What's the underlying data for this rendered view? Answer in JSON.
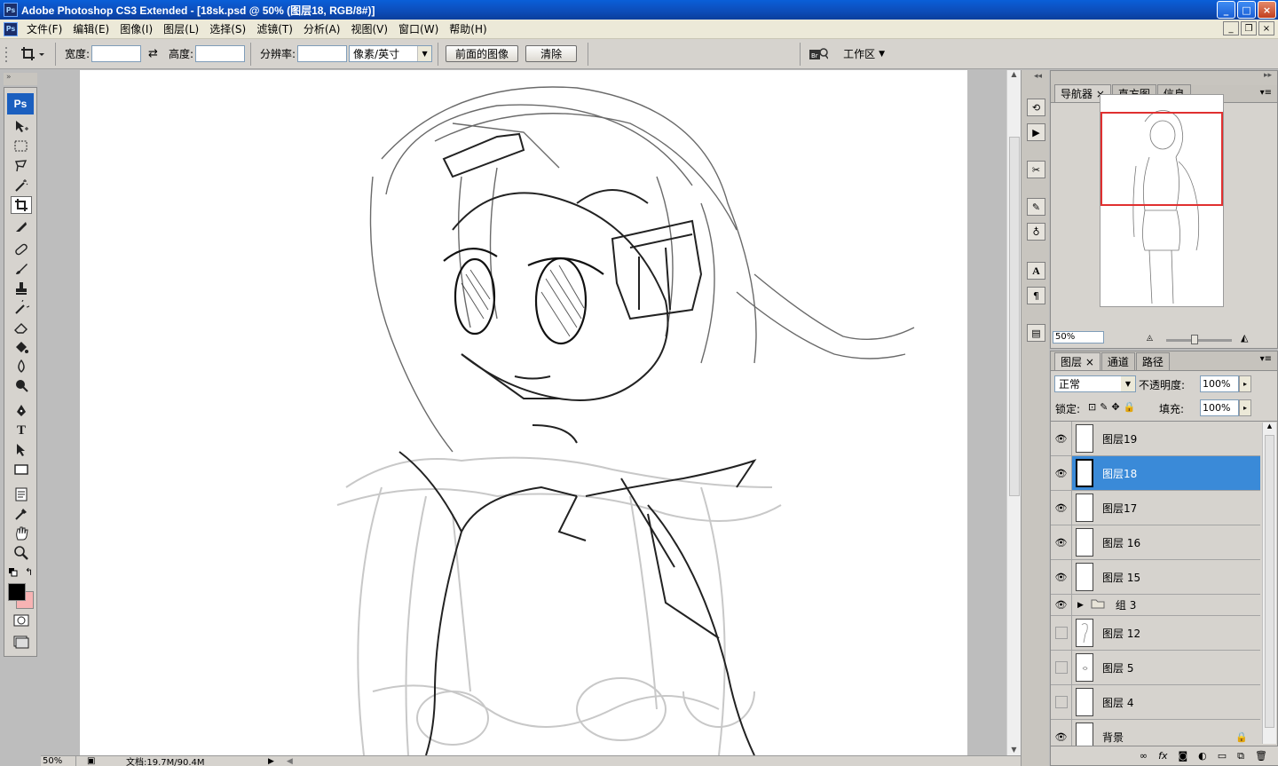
{
  "window": {
    "title": "Adobe Photoshop CS3 Extended - [18sk.psd @ 50% (图层18, RGB/8#)]",
    "min": "_",
    "max": "□",
    "close": "×",
    "doc_min": "_",
    "doc_restore": "❐",
    "doc_close": "×"
  },
  "menu": [
    "文件(F)",
    "编辑(E)",
    "图像(I)",
    "图层(L)",
    "选择(S)",
    "滤镜(T)",
    "分析(A)",
    "视图(V)",
    "窗口(W)",
    "帮助(H)"
  ],
  "options": {
    "width_label": "宽度:",
    "height_label": "高度:",
    "resolution_label": "分辨率:",
    "unit": "像素/英寸",
    "front_image": "前面的图像",
    "clear": "清除",
    "workspace": "工作区"
  },
  "toolbox": {
    "badge": "Ps"
  },
  "status": {
    "zoom": "50%",
    "doc": "文档:19.7M/90.4M"
  },
  "navigator": {
    "tabs": [
      "导航器",
      "直方图",
      "信息"
    ],
    "zoom": "50%"
  },
  "layers": {
    "tabs": [
      "图层",
      "通道",
      "路径"
    ],
    "blend": "正常",
    "opacity_label": "不透明度:",
    "opacity": "100%",
    "lock_label": "锁定:",
    "fill_label": "填充:",
    "fill": "100%",
    "items": [
      {
        "name": "图层19",
        "visible": true,
        "selected": false
      },
      {
        "name": "图层18",
        "visible": true,
        "selected": true
      },
      {
        "name": "图层17",
        "visible": true,
        "selected": false
      },
      {
        "name": "图层 16",
        "visible": true,
        "selected": false
      },
      {
        "name": "图层 15",
        "visible": true,
        "selected": false
      },
      {
        "name": "组 3",
        "visible": true,
        "selected": false,
        "group": true
      },
      {
        "name": "图层 12",
        "visible": false,
        "selected": false
      },
      {
        "name": "图层 5",
        "visible": false,
        "selected": false
      },
      {
        "name": "图层 4",
        "visible": false,
        "selected": false
      },
      {
        "name": "背景",
        "visible": true,
        "selected": false,
        "locked": true
      }
    ]
  },
  "colors": {
    "foreground": "#000000",
    "background": "#f7b3b3",
    "selection": "#3a8ad8"
  }
}
